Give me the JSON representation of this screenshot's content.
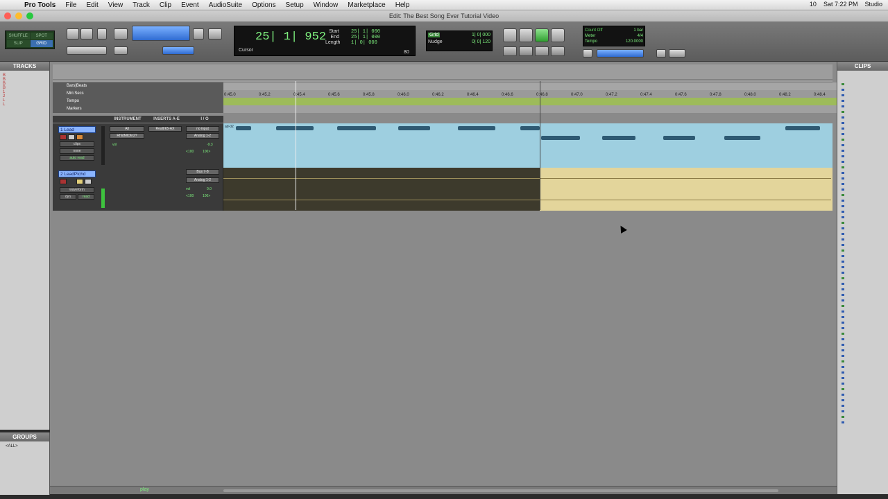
{
  "menubar": {
    "app_name": "Pro Tools",
    "items": [
      "File",
      "Edit",
      "View",
      "Track",
      "Clip",
      "Event",
      "AudioSuite",
      "Options",
      "Setup",
      "Window",
      "Marketplace",
      "Help"
    ],
    "status_right": [
      "10",
      "Sat 7:22 PM",
      "Studio"
    ]
  },
  "window_title": "Edit: The Best Song Ever Tutorial Video",
  "toolbar": {
    "modes": [
      "SHUFFLE",
      "SPOT",
      "SLIP",
      "GRID"
    ],
    "active_mode": "GRID",
    "main_counter": "25| 1| 952",
    "counter_labels": [
      "Start",
      "End",
      "Length"
    ],
    "counter_values": [
      "25| 1| 000",
      "25| 1| 000",
      "1| 0| 000"
    ],
    "cursor_label": "Cursor",
    "tempo_small": "80",
    "grid_label": "Grid",
    "grid_value": "1| 0| 000",
    "nudge_label": "Nudge",
    "nudge_value": "0| 0| 120",
    "countoff_lines": [
      "Count Off",
      "Meter",
      "Tempo"
    ],
    "countoff_values": [
      "1 bar",
      "4/4",
      "120.0000"
    ]
  },
  "tracks_panel": {
    "title": "TRACKS",
    "items": [
      "B",
      "B",
      "B",
      "B",
      "1",
      "2",
      "L",
      "L"
    ]
  },
  "groups_panel": {
    "title": "GROUPS",
    "items": [
      "<ALL>"
    ]
  },
  "clips_panel": {
    "title": "CLIPS"
  },
  "ruler": {
    "labels": [
      "0:45.0",
      "0:45.2",
      "0:45.4",
      "0:45.6",
      "0:45.8",
      "0:46.0",
      "0:46.2",
      "0:46.4",
      "0:46.6",
      "0:46.8",
      "0:47.0",
      "0:47.2",
      "0:47.4",
      "0:47.6",
      "0:47.8",
      "0:48.0",
      "0:48.2",
      "0:48.4"
    ],
    "rows": [
      "Bars|Beats",
      "Min:Secs",
      "Tempo",
      "Markers"
    ]
  },
  "column_headers": [
    "INSTRUMENT",
    "INSERTS A-E",
    "I / O"
  ],
  "tracks": [
    {
      "name": "1 Lead",
      "instrument": "All",
      "instrument2": "RhldMIDIn2?",
      "insert": "Realtrk5-AX",
      "io_in": "no input",
      "io_out": "Analog 1-2",
      "vol": "vol",
      "vol_val": "-9.3",
      "pan_val": "<100",
      "pan_val2": "100>",
      "clips_label": "clips",
      "none_label": "none",
      "auto_label": "auto read",
      "clip_name": "ad-02"
    },
    {
      "name": "2 LeadPtchd",
      "io_in": "Bus 7-8",
      "io_out": "Analog 1-2",
      "vol": "vol",
      "vol_val": "0.0",
      "pan_val": "<100",
      "pan_val2": "100>",
      "waveform_label": "waveform",
      "dyn_label": "dyn",
      "read_label": "read"
    }
  ],
  "statusbar": {
    "play_label": "play"
  }
}
